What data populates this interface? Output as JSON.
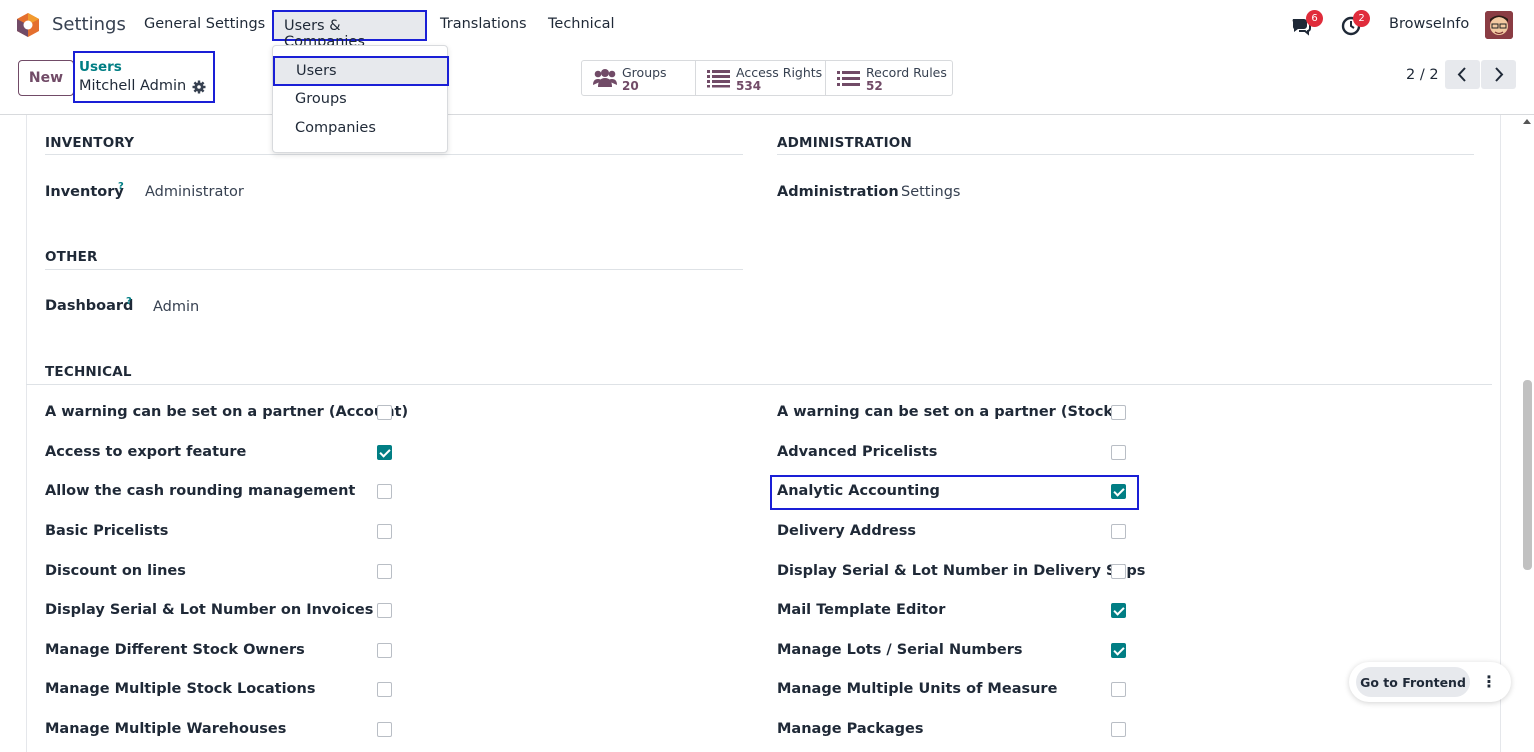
{
  "navbar": {
    "app_title": "Settings",
    "menu": [
      "General Settings",
      "Users & Companies",
      "Translations",
      "Technical"
    ],
    "messages_count": "6",
    "activities_count": "2",
    "company": "BrowseInfo"
  },
  "dropdown": {
    "items": [
      "Users",
      "Groups",
      "Companies"
    ]
  },
  "control": {
    "new_label": "New",
    "breadcrumb_parent": "Users",
    "breadcrumb_current": "Mitchell Admin",
    "stats": [
      {
        "label": "Groups",
        "value": "20"
      },
      {
        "label": "Access Rights",
        "value": "534"
      },
      {
        "label": "Record Rules",
        "value": "52"
      }
    ],
    "pager": "2 / 2"
  },
  "sections": {
    "inventory": {
      "title": "INVENTORY",
      "field_label": "Inventory",
      "help": "?",
      "value": "Administrator"
    },
    "administration": {
      "title": "ADMINISTRATION",
      "field_label": "Administration",
      "value": "Settings"
    },
    "other": {
      "title": "OTHER",
      "field_label": "Dashboard",
      "help": "?",
      "value": "Admin"
    },
    "technical": {
      "title": "TECHNICAL",
      "left": [
        {
          "label": "A warning can be set on a partner (Account)",
          "checked": false
        },
        {
          "label": "Access to export feature",
          "checked": true
        },
        {
          "label": "Allow the cash rounding management",
          "checked": false
        },
        {
          "label": "Basic Pricelists",
          "checked": false
        },
        {
          "label": "Discount on lines",
          "checked": false
        },
        {
          "label": "Display Serial & Lot Number on Invoices",
          "checked": false
        },
        {
          "label": "Manage Different Stock Owners",
          "checked": false
        },
        {
          "label": "Manage Multiple Stock Locations",
          "checked": false
        },
        {
          "label": "Manage Multiple Warehouses",
          "checked": false
        }
      ],
      "right": [
        {
          "label": "A warning can be set on a partner (Stock)",
          "checked": false
        },
        {
          "label": "Advanced Pricelists",
          "checked": false
        },
        {
          "label": "Analytic Accounting",
          "checked": true
        },
        {
          "label": "Delivery Address",
          "checked": false
        },
        {
          "label": "Display Serial & Lot Number in Delivery Slips",
          "checked": false
        },
        {
          "label": "Mail Template Editor",
          "checked": true
        },
        {
          "label": "Manage Lots / Serial Numbers",
          "checked": true
        },
        {
          "label": "Manage Multiple Units of Measure",
          "checked": false
        },
        {
          "label": "Manage Packages",
          "checked": false
        }
      ]
    }
  },
  "frontend_button": "Go to Frontend",
  "colors": {
    "accent": "#714b67",
    "teal": "#017e84",
    "highlight": "#1a1fd6",
    "badge": "#e02c3b"
  }
}
